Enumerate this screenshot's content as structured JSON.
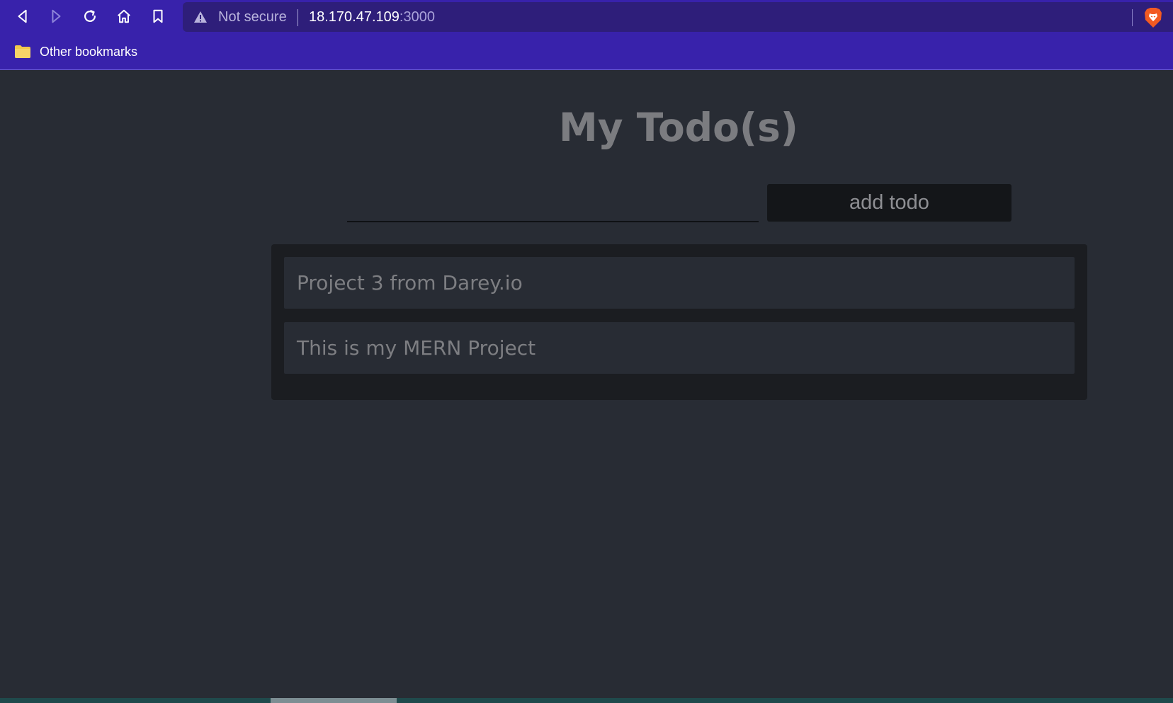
{
  "browser": {
    "nav_icons": [
      "back-icon",
      "forward-icon",
      "reload-icon",
      "home-icon",
      "bookmark-icon"
    ],
    "security_label": "Not secure",
    "url_host": "18.170.47.109",
    "url_port": ":3000",
    "bookmarks": [
      {
        "label": "Other bookmarks",
        "icon": "folder-icon"
      }
    ],
    "colors": {
      "chrome": "#3822ab",
      "omnibox": "#2e1e7a"
    }
  },
  "app": {
    "title": "My Todo(s)",
    "input_value": "",
    "add_button_label": "add todo",
    "todos": [
      "Project 3 from Darey.io",
      "This is my MERN Project"
    ],
    "colors": {
      "background": "#282c34",
      "list_background": "#1b1d21",
      "button": "#141619"
    }
  }
}
